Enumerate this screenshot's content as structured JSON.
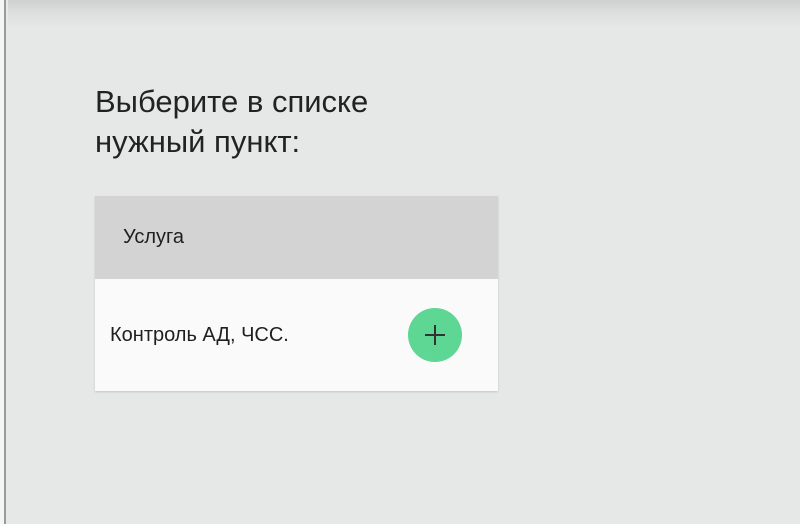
{
  "prompt": {
    "line1": "Выберите в списке",
    "line2": "нужный пункт:"
  },
  "table": {
    "header": "Услуга",
    "rows": [
      {
        "label": "Контроль АД, ЧСС.",
        "action_icon": "plus-icon"
      }
    ]
  },
  "colors": {
    "background": "#e6e7e7",
    "header_bg": "#d3d3d3",
    "row_bg": "#fafafa",
    "add_button": "#5ed694"
  }
}
